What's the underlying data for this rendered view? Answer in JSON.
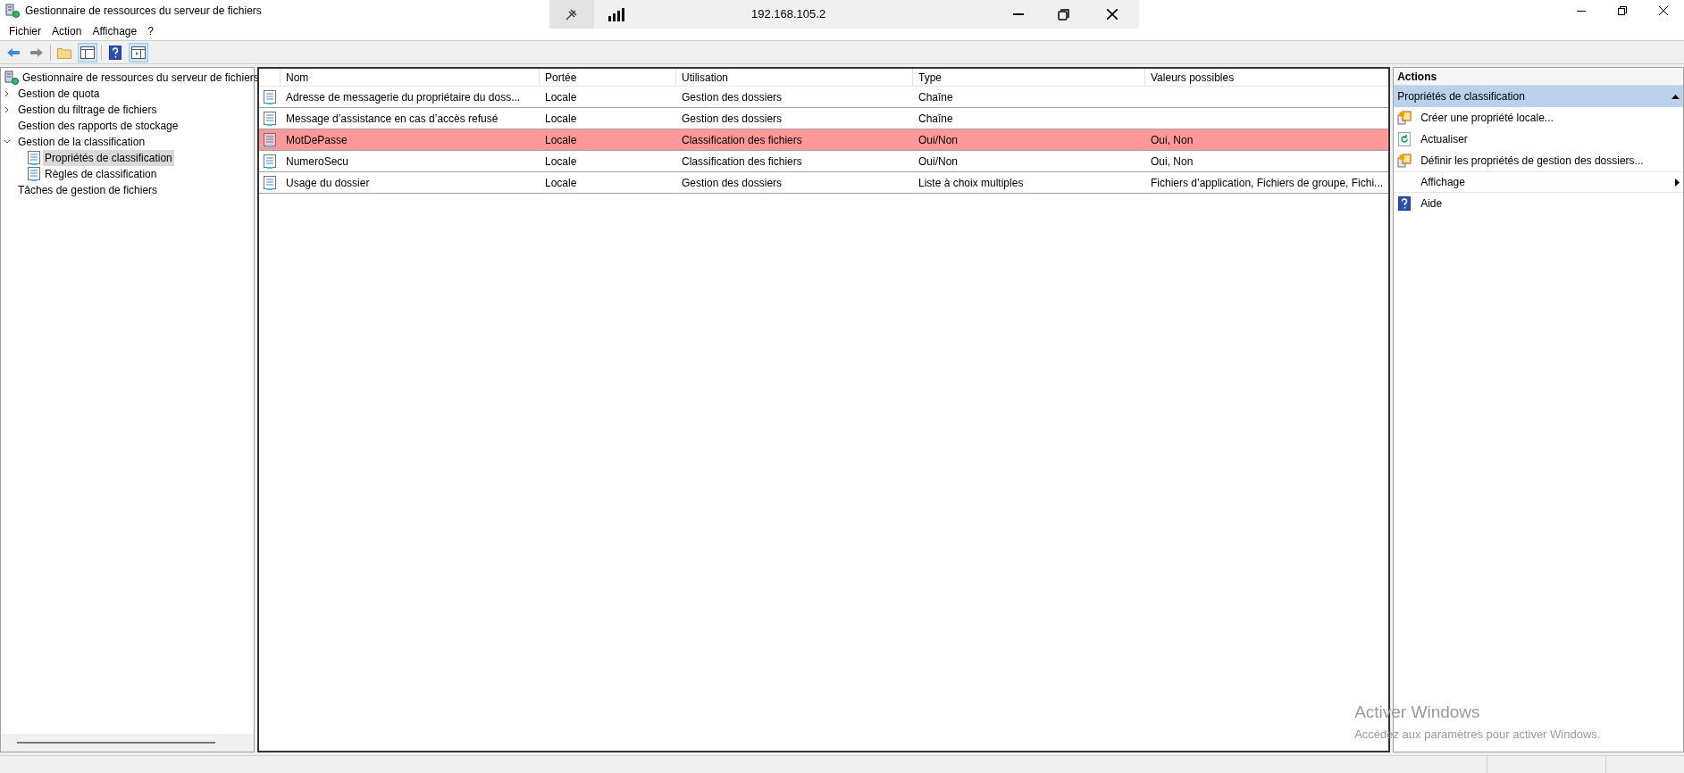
{
  "window": {
    "title": "Gestionnaire de ressources du serveur de fichiers"
  },
  "connection_bar": {
    "address": "192.168.105.2"
  },
  "menu": [
    "Fichier",
    "Action",
    "Affichage",
    "?"
  ],
  "tree": {
    "label": "Gestionnaire de ressources du serveur de fichiers",
    "children": [
      {
        "label": "Gestion de quota",
        "expanded": false,
        "selected": false
      },
      {
        "label": "Gestion du filtrage de fichiers",
        "expanded": false,
        "selected": false
      },
      {
        "label": "Gestion des rapports de stockage",
        "selected": false
      },
      {
        "label": "Gestion de la classification",
        "expanded": true,
        "selected": false,
        "children": [
          {
            "label": "Propriétés de classification",
            "selected": true
          },
          {
            "label": "Règles de classification",
            "selected": false
          }
        ]
      },
      {
        "label": "Tâches de gestion de fichiers",
        "selected": false
      }
    ]
  },
  "table": {
    "columns": [
      "Nom",
      "Portée",
      "Utilisation",
      "Type",
      "Valeurs possibles"
    ],
    "rows": [
      {
        "cells": [
          "Adresse de messagerie du propriétaire du doss...",
          "Locale",
          "Gestion des dossiers",
          "Chaîne",
          ""
        ],
        "selected": false
      },
      {
        "cells": [
          "Message d’assistance en cas d’accès refusé",
          "Locale",
          "Gestion des dossiers",
          "Chaîne",
          ""
        ],
        "selected": false
      },
      {
        "cells": [
          "MotDePasse",
          "Locale",
          "Classification des fichiers",
          "Oui/Non",
          "Oui, Non"
        ],
        "selected": true
      },
      {
        "cells": [
          "NumeroSecu",
          "Locale",
          "Classification des fichiers",
          "Oui/Non",
          "Oui, Non"
        ],
        "selected": false
      },
      {
        "cells": [
          "Usage du dossier",
          "Locale",
          "Gestion des dossiers",
          "Liste à choix multiples",
          "Fichiers d’application, Fichiers de groupe, Fichi..."
        ],
        "selected": false
      }
    ]
  },
  "actions": {
    "title": "Actions",
    "section": "Propriétés de classification",
    "expanded": true,
    "items": [
      {
        "label": "Créer une propriété locale...",
        "kind": "property"
      },
      {
        "label": "Actualiser",
        "kind": "refresh"
      },
      {
        "label": "Définir les propriétés de gestion des dossiers...",
        "kind": "property"
      },
      {
        "label": "Affichage",
        "kind": "submenu"
      },
      {
        "label": "Aide",
        "kind": "help"
      }
    ]
  },
  "activation_notice": {
    "title": "Activer Windows",
    "text": "Accédez aux paramètres pour activer Windows."
  }
}
